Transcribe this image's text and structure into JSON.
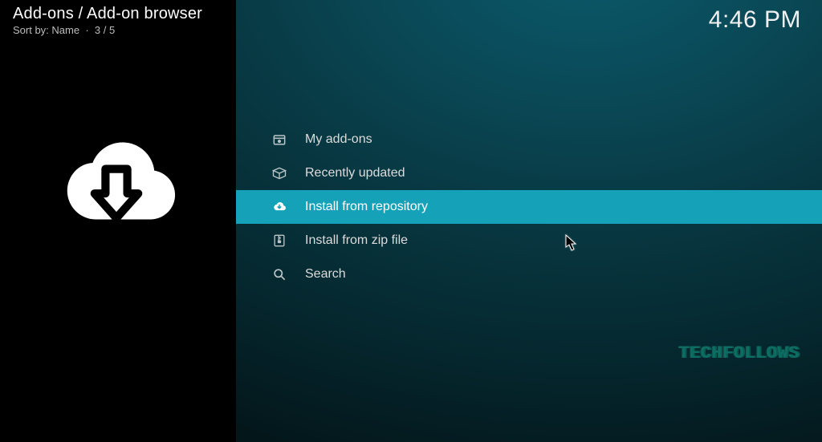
{
  "header": {
    "breadcrumb": "Add-ons / Add-on browser",
    "sort_prefix": "Sort by:",
    "sort_value": "Name",
    "position": "3 / 5"
  },
  "clock": "4:46 PM",
  "sidebar": {
    "hero_icon": "cloud-download"
  },
  "menu": {
    "items": [
      {
        "icon": "addons-box-icon",
        "label": "My add-ons",
        "selected": false
      },
      {
        "icon": "open-box-icon",
        "label": "Recently updated",
        "selected": false
      },
      {
        "icon": "cloud-download-icon",
        "label": "Install from repository",
        "selected": true
      },
      {
        "icon": "zip-file-icon",
        "label": "Install from zip file",
        "selected": false
      },
      {
        "icon": "search-icon",
        "label": "Search",
        "selected": false
      }
    ]
  },
  "watermark": "TECHFOLLOWS",
  "colors": {
    "highlight": "#15a2b8",
    "background_dark": "#03171b",
    "background_light": "#0b5a6c"
  }
}
